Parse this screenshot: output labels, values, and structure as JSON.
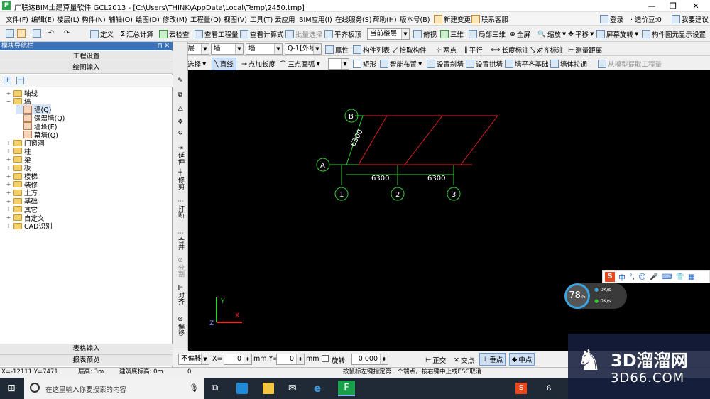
{
  "window": {
    "icon_letter": "F",
    "title": "广联达BIM土建算量软件 GCL2013 - [C:\\Users\\THINK\\AppData\\Local\\Temp\\2450.tmp]",
    "minimize": "—",
    "restore": "❐",
    "close": "✕"
  },
  "menubar": {
    "items": [
      "文件(F)",
      "编辑(E)",
      "楼层(L)",
      "构件(N)",
      "辅轴(O)",
      "绘图(D)",
      "修改(M)",
      "工程量(Q)",
      "视图(V)",
      "工具(T)",
      "云应用",
      "BIM应用(I)",
      "在线服务(S)",
      "帮助(H)",
      "版本号(B)",
      "新建变更",
      "联系客服"
    ],
    "right": {
      "login": "登录",
      "price": "· 造价豆:0",
      "suggest": "我要建议"
    }
  },
  "toolbar1": {
    "define": "定义",
    "sum_calc": "汇总计算",
    "cloud_check": "云检查",
    "view_quantity": "查看工程量",
    "view_formula": "查看计算式",
    "batch_select": "批量选择",
    "flat_slab": "平齐板顶",
    "current_floor": "当前楼层",
    "top_view": "俯视",
    "three_d": "三维",
    "local_3d": "局部三维",
    "fullscreen": "全屏",
    "zoom": "缩放",
    "pan": "平移",
    "rotate": "屏幕旋转",
    "show_settings": "构件图元显示设置"
  },
  "toolbar2": {
    "floor": "首层",
    "category": "墙",
    "type": "墙",
    "component": "Q-1[外墙",
    "properties": "属性",
    "component_list": "构件列表",
    "pick": "拾取构件",
    "two_points": "两点",
    "parallel": "平行",
    "length_mark": "长度标注",
    "aligned_mark": "对齐标注",
    "measure": "测量距离"
  },
  "toolbar3": {
    "select": "选择",
    "line": "直线",
    "point_length": "点加长度",
    "arc": "三点画弧",
    "rect": "矩形",
    "smart_layout": "智能布置",
    "set_slope": "设置斜墙",
    "set_arch": "设置拱墙",
    "align_base": "墙平齐基础",
    "wall_pull": "墙体拉通",
    "extract": "从模型提取工程量"
  },
  "leftpanel": {
    "header": "模块导航栏",
    "pin": "⊓ ✕",
    "project_settings": "工程设置",
    "drawing_input": "绘图输入",
    "table_input": "表格输入",
    "report_preview": "报表预览",
    "tree": [
      {
        "label": "轴线",
        "level": 0,
        "exp": "+",
        "icon": "folder"
      },
      {
        "label": "墙",
        "level": 0,
        "exp": "−",
        "icon": "folder"
      },
      {
        "label": "墙(Q)",
        "level": 1,
        "exp": "",
        "icon": "leaf"
      },
      {
        "label": "保温墙(Q)",
        "level": 1,
        "exp": "",
        "icon": "leaf"
      },
      {
        "label": "墙垛(E)",
        "level": 1,
        "exp": "",
        "icon": "leaf"
      },
      {
        "label": "幕墙(Q)",
        "level": 1,
        "exp": "",
        "icon": "leaf"
      },
      {
        "label": "门窗洞",
        "level": 0,
        "exp": "+",
        "icon": "folder"
      },
      {
        "label": "柱",
        "level": 0,
        "exp": "+",
        "icon": "folder"
      },
      {
        "label": "梁",
        "level": 0,
        "exp": "+",
        "icon": "folder"
      },
      {
        "label": "板",
        "level": 0,
        "exp": "+",
        "icon": "folder"
      },
      {
        "label": "楼梯",
        "level": 0,
        "exp": "+",
        "icon": "folder"
      },
      {
        "label": "装修",
        "level": 0,
        "exp": "+",
        "icon": "folder"
      },
      {
        "label": "土方",
        "level": 0,
        "exp": "+",
        "icon": "folder"
      },
      {
        "label": "基础",
        "level": 0,
        "exp": "+",
        "icon": "folder"
      },
      {
        "label": "其它",
        "level": 0,
        "exp": "+",
        "icon": "folder"
      },
      {
        "label": "自定义",
        "level": 0,
        "exp": "+",
        "icon": "folder"
      },
      {
        "label": "CAD识别",
        "level": 0,
        "exp": "+",
        "icon": "folder"
      }
    ]
  },
  "vtools": {
    "extend": "延伸",
    "trim": "修剪",
    "break": "打断",
    "merge": "合并",
    "split": "分割",
    "align": "对齐",
    "offset": "偏移"
  },
  "canvas": {
    "axis_labels": {
      "a": "A",
      "b": "B",
      "c1": "1",
      "c2": "2",
      "c3": "3"
    },
    "dims": {
      "d1": "6300",
      "d2": "6300",
      "d3": "6300"
    },
    "ucs": {
      "y": "Y",
      "x": "X",
      "z": "Z"
    }
  },
  "overlay": {
    "net_percent": "78",
    "percent_sign": "%",
    "up_speed": "0K/s",
    "down_speed": "0K/s",
    "ime_label": "中"
  },
  "bottombar": {
    "offset_mode": "不偏移",
    "x_label": "X=",
    "x_val": "0",
    "y_label": "mm Y=",
    "y_val": "0",
    "mm": "mm",
    "rotate": "旋转",
    "rot_val": "0.000",
    "ortho": "正交",
    "intersect": "交点",
    "perp": "垂点",
    "mid": "中点"
  },
  "statusbar": {
    "coords": "X=-12111 Y=7471",
    "floor_height": "层高: 3m",
    "base_elev": "建筑底标高: 0m",
    "zero": "0",
    "hint": "按鼠标左键指定第一个端点，按右键中止或ESC取消"
  },
  "taskbar": {
    "search": "在这里输入你要搜索的内容"
  },
  "watermark": {
    "brand": "3D溜溜网",
    "url": "3D66.COM"
  },
  "colors": {
    "grid_green": "#33cc33",
    "wall_red": "#e02020",
    "canvas_bg": "#000000",
    "nav_blue": "#3b71b8"
  }
}
